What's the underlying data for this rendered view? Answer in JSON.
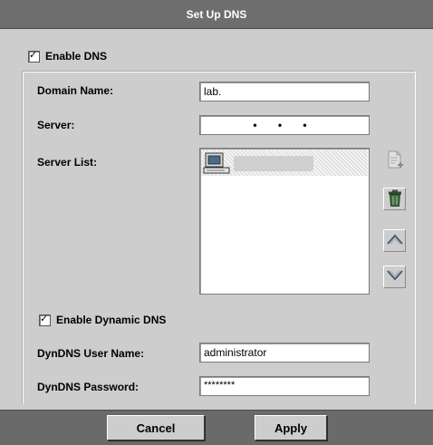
{
  "window": {
    "title": "Set Up DNS"
  },
  "enable_dns": {
    "label": "Enable DNS",
    "checked": true
  },
  "domain_name": {
    "label": "Domain Name:",
    "value": "lab."
  },
  "server": {
    "label": "Server:",
    "value": "•   •   •"
  },
  "server_list": {
    "label": "Server List:",
    "items": [
      {
        "text": "",
        "icon": "computer-icon",
        "selected": true
      }
    ]
  },
  "list_buttons": {
    "add_icon": "add-page-icon",
    "delete_icon": "trash-icon",
    "up_icon": "chevron-up-icon",
    "down_icon": "chevron-down-icon"
  },
  "enable_dynamic_dns": {
    "label": "Enable Dynamic DNS",
    "checked": true
  },
  "dyndns_user": {
    "label": "DynDNS User Name:",
    "value": "administrator"
  },
  "dyndns_password": {
    "label": "DynDNS Password:",
    "value": "********"
  },
  "footer": {
    "cancel_label": "Cancel",
    "apply_label": "Apply"
  },
  "colors": {
    "titlebar": "#6e6e6e",
    "background": "#cdcdcd",
    "footer": "#6a6a6a"
  }
}
